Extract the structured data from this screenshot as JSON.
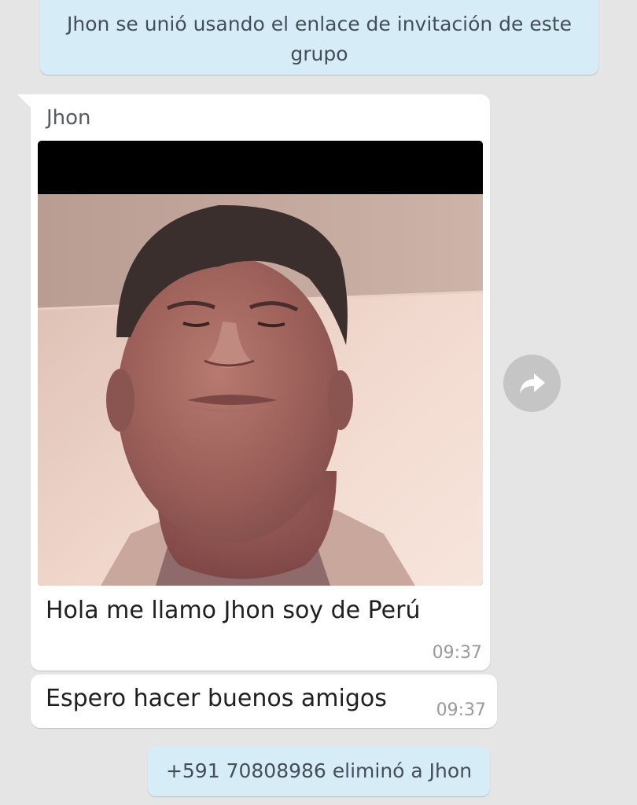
{
  "colors": {
    "chat_background": "#e5e5e5",
    "system_notice_background": "#d6ecf6",
    "bubble_background": "#ffffff",
    "timestamp": "#9a9a9a",
    "forward_button": "#c5c5c5"
  },
  "system_messages": {
    "join": "Jhon se unió usando el enlace de invitación de este grupo",
    "removed": "+591 70808986 eliminó a Jhon"
  },
  "messages": [
    {
      "sender": "Jhon",
      "type": "photo",
      "caption": "Hola me llamo Jhon soy de Perú",
      "time": "09:37"
    },
    {
      "type": "text",
      "text": "Espero hacer buenos amigos",
      "time": "09:37"
    }
  ],
  "icons": {
    "forward": "forward-arrow-icon"
  }
}
